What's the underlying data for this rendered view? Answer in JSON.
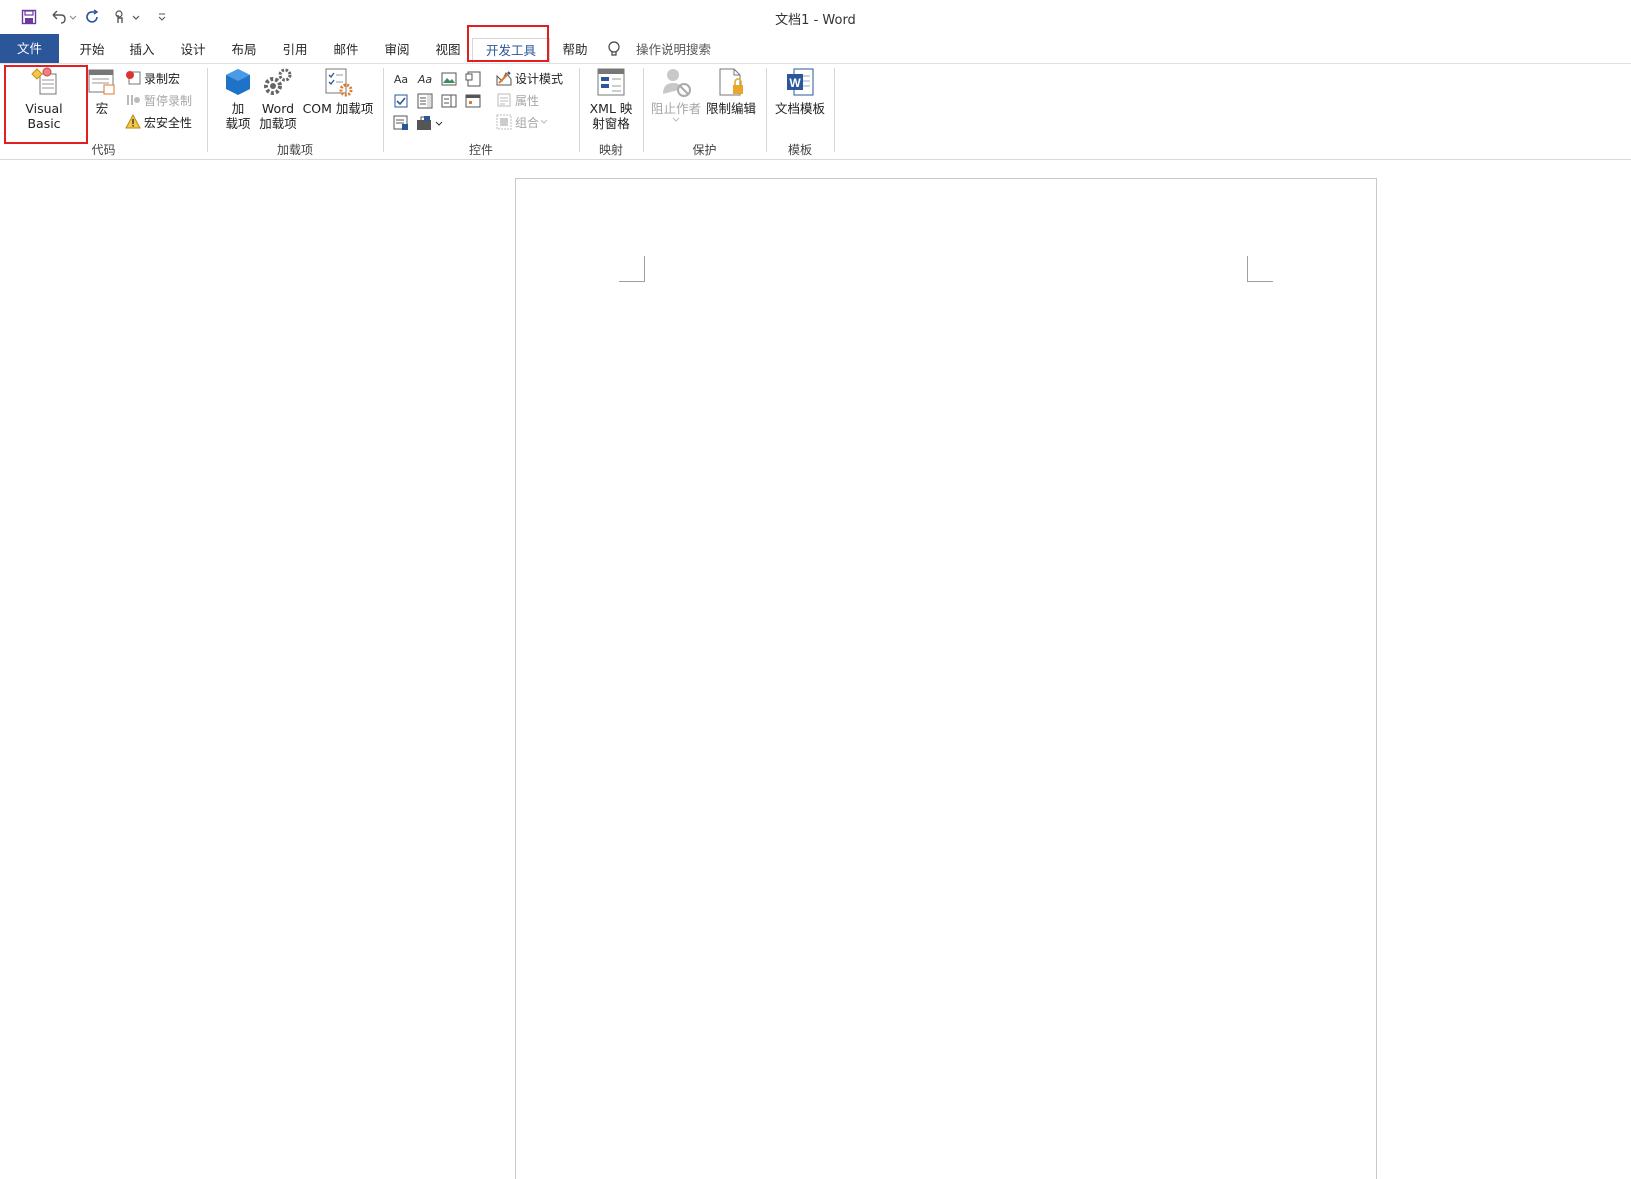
{
  "window": {
    "title": "文档1  -  Word"
  },
  "quick_access": {
    "icons": [
      "save-icon",
      "undo-icon",
      "redo-icon",
      "touch-mode-icon",
      "customize-qat-icon"
    ]
  },
  "tabs": [
    {
      "label": "文件"
    },
    {
      "label": "开始"
    },
    {
      "label": "插入"
    },
    {
      "label": "设计"
    },
    {
      "label": "布局"
    },
    {
      "label": "引用"
    },
    {
      "label": "邮件"
    },
    {
      "label": "审阅"
    },
    {
      "label": "视图"
    },
    {
      "label": "开发工具"
    },
    {
      "label": "帮助"
    }
  ],
  "active_tab": "开发工具",
  "tell_me": {
    "text": "操作说明搜索"
  },
  "ribbon": {
    "code": {
      "label": "代码",
      "visual_basic": "Visual Basic",
      "macros": "宏",
      "record_macro": "录制宏",
      "pause_recording": "暂停录制",
      "macro_security": "宏安全性"
    },
    "addins": {
      "label": "加载项",
      "addins_line1": "加",
      "addins_line2": "载项",
      "word_addins_line1": "Word",
      "word_addins_line2": "加载项",
      "com_addins": "COM 加载项"
    },
    "controls": {
      "label": "控件",
      "design_mode": "设计模式",
      "properties": "属性",
      "group": "组合",
      "rich_text": "Aa",
      "plain_text": "Aa"
    },
    "mapping": {
      "label": "映射",
      "xml_line1": "XML 映",
      "xml_line2": "射窗格"
    },
    "protect": {
      "label": "保护",
      "block_authors": "阻止作者",
      "restrict_editing": "限制编辑"
    },
    "templates": {
      "label": "模板",
      "document_template": "文档模板"
    }
  },
  "colors": {
    "accent": "#2b579a",
    "highlight_box": "#e02020"
  }
}
